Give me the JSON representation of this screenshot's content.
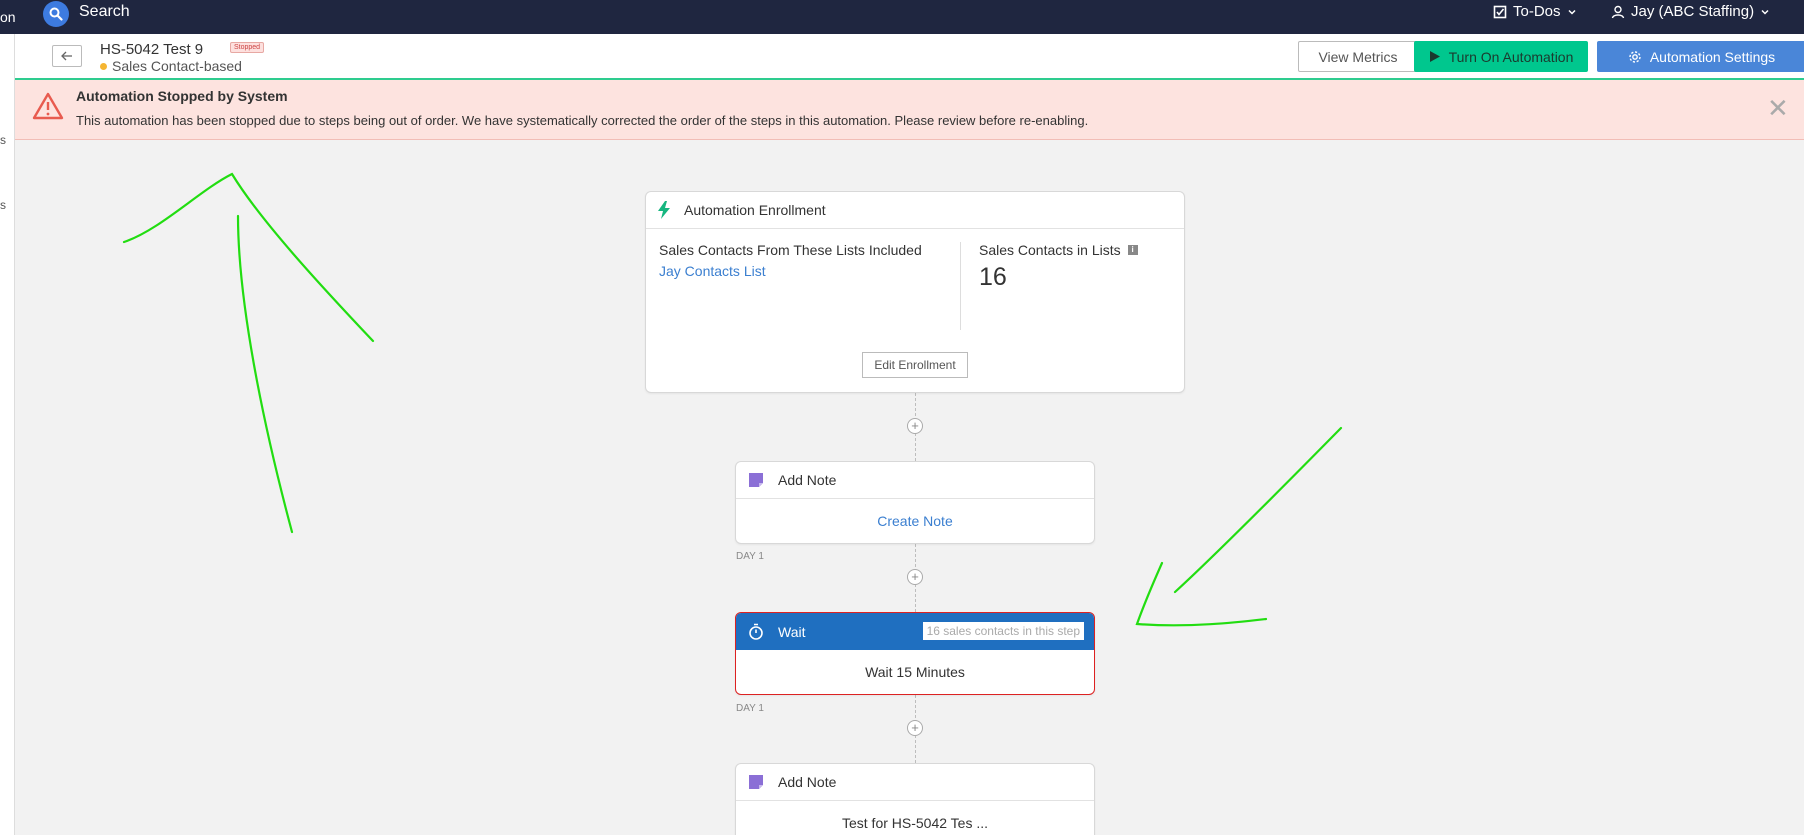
{
  "topnav": {
    "cut_text": "on",
    "search_label": "Search",
    "todos_label": "To-Dos",
    "user_label": "Jay (ABC Staffing)"
  },
  "leftrail": {
    "frag1": "s",
    "frag2": "s"
  },
  "header": {
    "title": "HS-5042 Test 9",
    "status_badge": "Stopped",
    "subtitle": "Sales Contact-based",
    "view_metrics": "View Metrics",
    "turn_on": "Turn On Automation",
    "settings": "Automation Settings"
  },
  "alert": {
    "title": "Automation Stopped by System",
    "message": "This automation has been stopped due to steps being out of order. We have systematically corrected the order of the steps in this automation. Please review before re-enabling."
  },
  "enrollment": {
    "title": "Automation Enrollment",
    "lists_title": "Sales Contacts From These Lists Included",
    "list_link": "Jay Contacts List",
    "count_label": "Sales Contacts in Lists",
    "count": "16",
    "edit_button": "Edit Enrollment"
  },
  "steps": [
    {
      "title": "Add Note",
      "body": "Create Note",
      "day": "DAY 1"
    },
    {
      "title": "Wait",
      "pill": "16 sales contacts in this step",
      "body": "Wait 15 Minutes",
      "day": "DAY 1"
    },
    {
      "title": "Add Note",
      "body": "Test for HS-5042 Tes ..."
    }
  ],
  "colors": {
    "nav": "#1f2640",
    "turn_on": "#00c78e",
    "settings": "#4a86d8",
    "alert_bg": "#fde3df",
    "wait_header": "#1f6fc0",
    "wait_border": "#dd2222",
    "annotation": "#22dd11"
  }
}
